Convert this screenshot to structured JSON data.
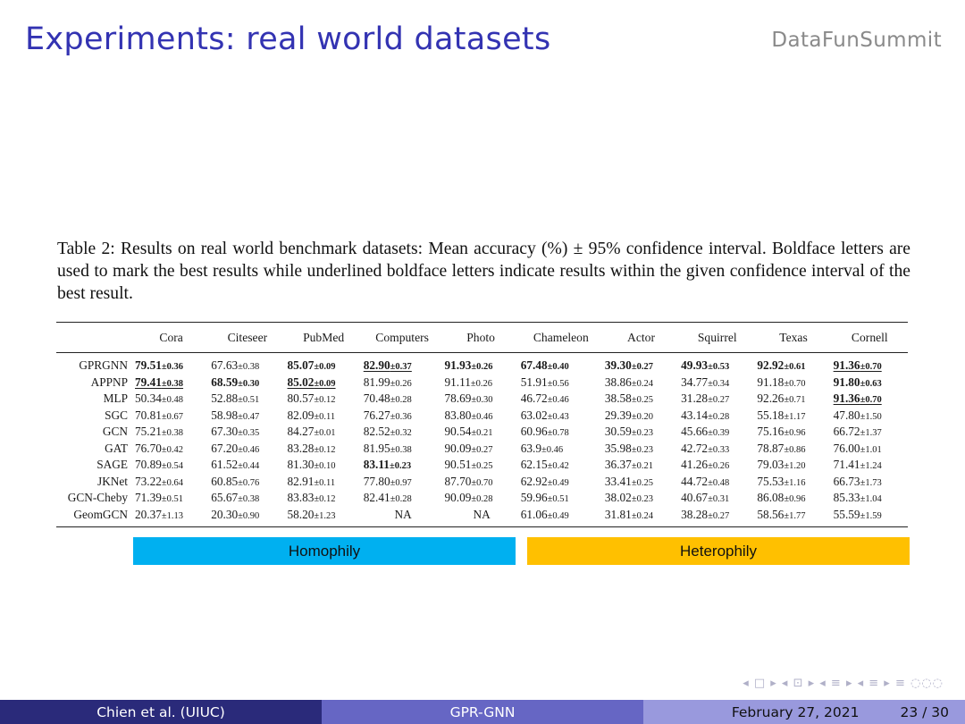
{
  "header": {
    "title": "Experiments: real world datasets",
    "brand": "DataFunSummit"
  },
  "caption": "Table 2: Results on real world benchmark datasets: Mean accuracy (%) ± 95% confidence interval. Boldface letters are used to mark the best results while underlined boldface letters indicate results within the given confidence interval of the best result.",
  "table": {
    "columns": [
      "Cora",
      "Citeseer",
      "PubMed",
      "Computers",
      "Photo",
      "Chameleon",
      "Actor",
      "Squirrel",
      "Texas",
      "Cornell"
    ],
    "rows": [
      {
        "name": "GPRGNN",
        "cells": [
          {
            "v": "79.51",
            "ci": "±0.36",
            "b": true
          },
          {
            "v": "67.63",
            "ci": "±0.38"
          },
          {
            "v": "85.07",
            "ci": "±0.09",
            "b": true
          },
          {
            "v": "82.90",
            "ci": "±0.37",
            "b": true,
            "u": true
          },
          {
            "v": "91.93",
            "ci": "±0.26",
            "b": true
          },
          {
            "v": "67.48",
            "ci": "±0.40",
            "b": true
          },
          {
            "v": "39.30",
            "ci": "±0.27",
            "b": true
          },
          {
            "v": "49.93",
            "ci": "±0.53",
            "b": true
          },
          {
            "v": "92.92",
            "ci": "±0.61",
            "b": true
          },
          {
            "v": "91.36",
            "ci": "±0.70",
            "b": true,
            "u": true
          }
        ]
      },
      {
        "name": "APPNP",
        "cells": [
          {
            "v": "79.41",
            "ci": "±0.38",
            "b": true,
            "u": true
          },
          {
            "v": "68.59",
            "ci": "±0.30",
            "b": true
          },
          {
            "v": "85.02",
            "ci": "±0.09",
            "b": true,
            "u": true
          },
          {
            "v": "81.99",
            "ci": "±0.26"
          },
          {
            "v": "91.11",
            "ci": "±0.26"
          },
          {
            "v": "51.91",
            "ci": "±0.56"
          },
          {
            "v": "38.86",
            "ci": "±0.24"
          },
          {
            "v": "34.77",
            "ci": "±0.34"
          },
          {
            "v": "91.18",
            "ci": "±0.70"
          },
          {
            "v": "91.80",
            "ci": "±0.63",
            "b": true
          }
        ]
      },
      {
        "name": "MLP",
        "cells": [
          {
            "v": "50.34",
            "ci": "±0.48"
          },
          {
            "v": "52.88",
            "ci": "±0.51"
          },
          {
            "v": "80.57",
            "ci": "±0.12"
          },
          {
            "v": "70.48",
            "ci": "±0.28"
          },
          {
            "v": "78.69",
            "ci": "±0.30"
          },
          {
            "v": "46.72",
            "ci": "±0.46"
          },
          {
            "v": "38.58",
            "ci": "±0.25"
          },
          {
            "v": "31.28",
            "ci": "±0.27"
          },
          {
            "v": "92.26",
            "ci": "±0.71"
          },
          {
            "v": "91.36",
            "ci": "±0.70",
            "b": true,
            "u": true
          }
        ]
      },
      {
        "name": "SGC",
        "cells": [
          {
            "v": "70.81",
            "ci": "±0.67"
          },
          {
            "v": "58.98",
            "ci": "±0.47"
          },
          {
            "v": "82.09",
            "ci": "±0.11"
          },
          {
            "v": "76.27",
            "ci": "±0.36"
          },
          {
            "v": "83.80",
            "ci": "±0.46"
          },
          {
            "v": "63.02",
            "ci": "±0.43"
          },
          {
            "v": "29.39",
            "ci": "±0.20"
          },
          {
            "v": "43.14",
            "ci": "±0.28"
          },
          {
            "v": "55.18",
            "ci": "±1.17"
          },
          {
            "v": "47.80",
            "ci": "±1.50"
          }
        ]
      },
      {
        "name": "GCN",
        "cells": [
          {
            "v": "75.21",
            "ci": "±0.38"
          },
          {
            "v": "67.30",
            "ci": "±0.35"
          },
          {
            "v": "84.27",
            "ci": "±0.01"
          },
          {
            "v": "82.52",
            "ci": "±0.32"
          },
          {
            "v": "90.54",
            "ci": "±0.21"
          },
          {
            "v": "60.96",
            "ci": "±0.78"
          },
          {
            "v": "30.59",
            "ci": "±0.23"
          },
          {
            "v": "45.66",
            "ci": "±0.39"
          },
          {
            "v": "75.16",
            "ci": "±0.96"
          },
          {
            "v": "66.72",
            "ci": "±1.37"
          }
        ]
      },
      {
        "name": "GAT",
        "cells": [
          {
            "v": "76.70",
            "ci": "±0.42"
          },
          {
            "v": "67.20",
            "ci": "±0.46"
          },
          {
            "v": "83.28",
            "ci": "±0.12"
          },
          {
            "v": "81.95",
            "ci": "±0.38"
          },
          {
            "v": "90.09",
            "ci": "±0.27"
          },
          {
            "v": "63.9",
            "ci": "±0.46"
          },
          {
            "v": "35.98",
            "ci": "±0.23"
          },
          {
            "v": "42.72",
            "ci": "±0.33"
          },
          {
            "v": "78.87",
            "ci": "±0.86"
          },
          {
            "v": "76.00",
            "ci": "±1.01"
          }
        ]
      },
      {
        "name": "SAGE",
        "cells": [
          {
            "v": "70.89",
            "ci": "±0.54"
          },
          {
            "v": "61.52",
            "ci": "±0.44"
          },
          {
            "v": "81.30",
            "ci": "±0.10"
          },
          {
            "v": "83.11",
            "ci": "±0.23",
            "b": true
          },
          {
            "v": "90.51",
            "ci": "±0.25"
          },
          {
            "v": "62.15",
            "ci": "±0.42"
          },
          {
            "v": "36.37",
            "ci": "±0.21"
          },
          {
            "v": "41.26",
            "ci": "±0.26"
          },
          {
            "v": "79.03",
            "ci": "±1.20"
          },
          {
            "v": "71.41",
            "ci": "±1.24"
          }
        ]
      },
      {
        "name": "JKNet",
        "cells": [
          {
            "v": "73.22",
            "ci": "±0.64"
          },
          {
            "v": "60.85",
            "ci": "±0.76"
          },
          {
            "v": "82.91",
            "ci": "±0.11"
          },
          {
            "v": "77.80",
            "ci": "±0.97"
          },
          {
            "v": "87.70",
            "ci": "±0.70"
          },
          {
            "v": "62.92",
            "ci": "±0.49"
          },
          {
            "v": "33.41",
            "ci": "±0.25"
          },
          {
            "v": "44.72",
            "ci": "±0.48"
          },
          {
            "v": "75.53",
            "ci": "±1.16"
          },
          {
            "v": "66.73",
            "ci": "±1.73"
          }
        ]
      },
      {
        "name": "GCN-Cheby",
        "cells": [
          {
            "v": "71.39",
            "ci": "±0.51"
          },
          {
            "v": "65.67",
            "ci": "±0.38"
          },
          {
            "v": "83.83",
            "ci": "±0.12"
          },
          {
            "v": "82.41",
            "ci": "±0.28"
          },
          {
            "v": "90.09",
            "ci": "±0.28"
          },
          {
            "v": "59.96",
            "ci": "±0.51"
          },
          {
            "v": "38.02",
            "ci": "±0.23"
          },
          {
            "v": "40.67",
            "ci": "±0.31"
          },
          {
            "v": "86.08",
            "ci": "±0.96"
          },
          {
            "v": "85.33",
            "ci": "±1.04"
          }
        ]
      },
      {
        "name": "GeomGCN",
        "cells": [
          {
            "v": "20.37",
            "ci": "±1.13"
          },
          {
            "v": "20.30",
            "ci": "±0.90"
          },
          {
            "v": "58.20",
            "ci": "±1.23"
          },
          {
            "v": "NA",
            "ci": ""
          },
          {
            "v": "NA",
            "ci": ""
          },
          {
            "v": "61.06",
            "ci": "±0.49"
          },
          {
            "v": "31.81",
            "ci": "±0.24"
          },
          {
            "v": "38.28",
            "ci": "±0.27"
          },
          {
            "v": "58.56",
            "ci": "±1.77"
          },
          {
            "v": "55.59",
            "ci": "±1.59"
          }
        ]
      }
    ]
  },
  "bands": {
    "homophily": "Homophily",
    "heterophily": "Heterophily",
    "homophily_color": "#00b0f0",
    "heterophily_color": "#ffc000"
  },
  "nav_symbols": "◂ □ ▸ ◂ ⊡ ▸ ◂ ≡ ▸ ◂ ≡ ▸ ≡ ◌◌◌",
  "footer": {
    "author": "Chien et al. (UIUC)",
    "title": "GPR-GNN",
    "date": "February 27, 2021",
    "page": "23 / 30"
  },
  "colors": {
    "title": "#3333b2",
    "footer_left": "#2a2a7a",
    "footer_mid": "#6666c4",
    "footer_right": "#9999dd"
  }
}
